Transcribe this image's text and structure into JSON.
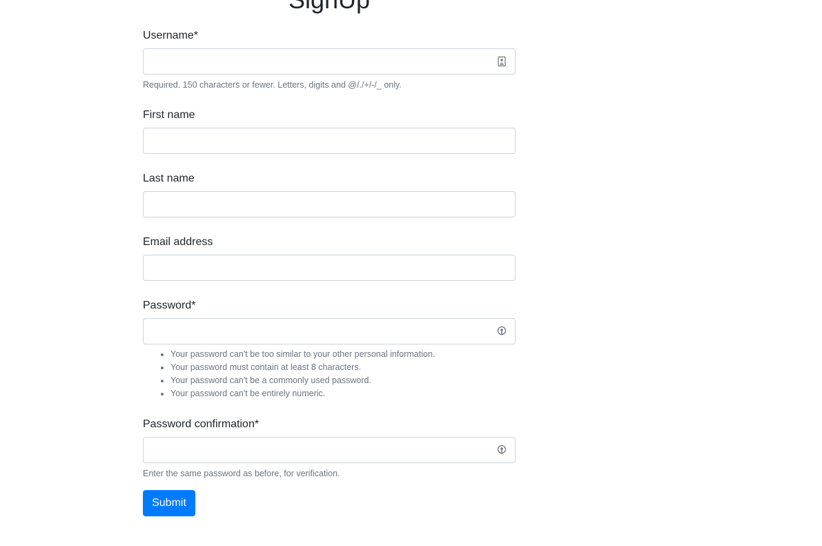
{
  "page": {
    "title": "SignUp"
  },
  "form": {
    "username": {
      "label": "Username*",
      "value": "",
      "help": "Required. 150 characters or fewer. Letters, digits and @/./+/-/_ only.",
      "icon": "contact-card-icon"
    },
    "first_name": {
      "label": "First name",
      "value": ""
    },
    "last_name": {
      "label": "Last name",
      "value": ""
    },
    "email": {
      "label": "Email address",
      "value": ""
    },
    "password": {
      "label": "Password*",
      "value": "",
      "icon": "password-key-icon",
      "rules": [
        "Your password can't be too similar to your other personal information.",
        "Your password must contain at least 8 characters.",
        "Your password can't be a commonly used password.",
        "Your password can't be entirely numeric."
      ]
    },
    "password_confirmation": {
      "label": "Password confirmation*",
      "value": "",
      "help": "Enter the same password as before, for verification.",
      "icon": "password-key-icon"
    },
    "submit_label": "Submit"
  },
  "colors": {
    "primary": "#007bff",
    "text": "#212529",
    "muted": "#6c757d",
    "border": "#ced4da"
  }
}
